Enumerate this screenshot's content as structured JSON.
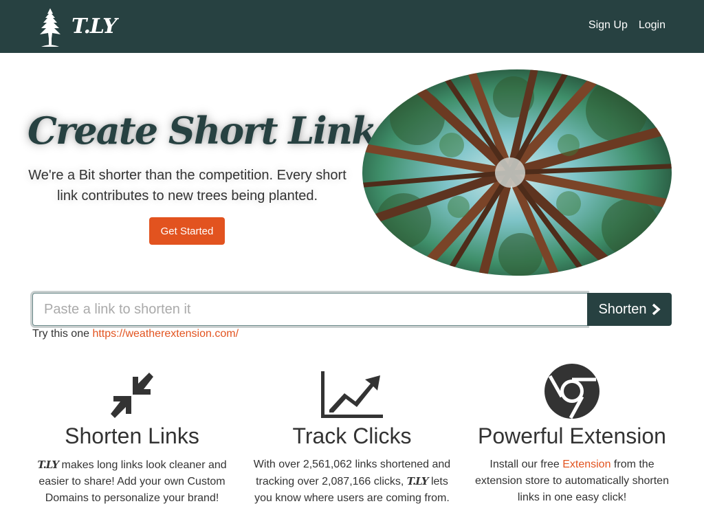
{
  "navbar": {
    "brand_text": "T.LY",
    "logo_icon": "tree-icon",
    "links": [
      "Sign Up",
      "Login"
    ],
    "background": "#274141"
  },
  "hero": {
    "title": "Create Short Links!",
    "subtitle": "We're a Bit shorter than the competition. Every short link contributes to new trees being planted.",
    "cta_label": "Get Started",
    "cta_color": "#e2531f",
    "image": "forest-canopy-photo"
  },
  "shorten": {
    "placeholder": "Paste a link to shorten it",
    "value": "",
    "button_label": "Shorten",
    "button_icon": "chevron-right-icon",
    "try_prefix": "Try this one",
    "try_link": "https://weatherextension.com/"
  },
  "features": [
    {
      "icon": "compress-arrows-icon",
      "title": "Shorten Links",
      "desc_brand": "T.LY",
      "desc_text": " makes long links look cleaner and easier to share! Add your own Custom Domains to personalize your brand!"
    },
    {
      "icon": "area-chart-icon",
      "title": "Track Clicks",
      "desc_pre": "With over 2,561,062 links shortened and tracking over 2,087,166 clicks, ",
      "desc_brand": "T.LY",
      "desc_post": " lets you know where users are coming from."
    },
    {
      "icon": "chrome-icon",
      "title": "Powerful Extension",
      "desc_pre": "Install our free ",
      "desc_link": "Extension",
      "desc_post": " from the extension store to automatically shorten links in one easy click!"
    }
  ],
  "colors": {
    "accent": "#e2531f",
    "brand_dark": "#274141",
    "text": "#333333"
  }
}
